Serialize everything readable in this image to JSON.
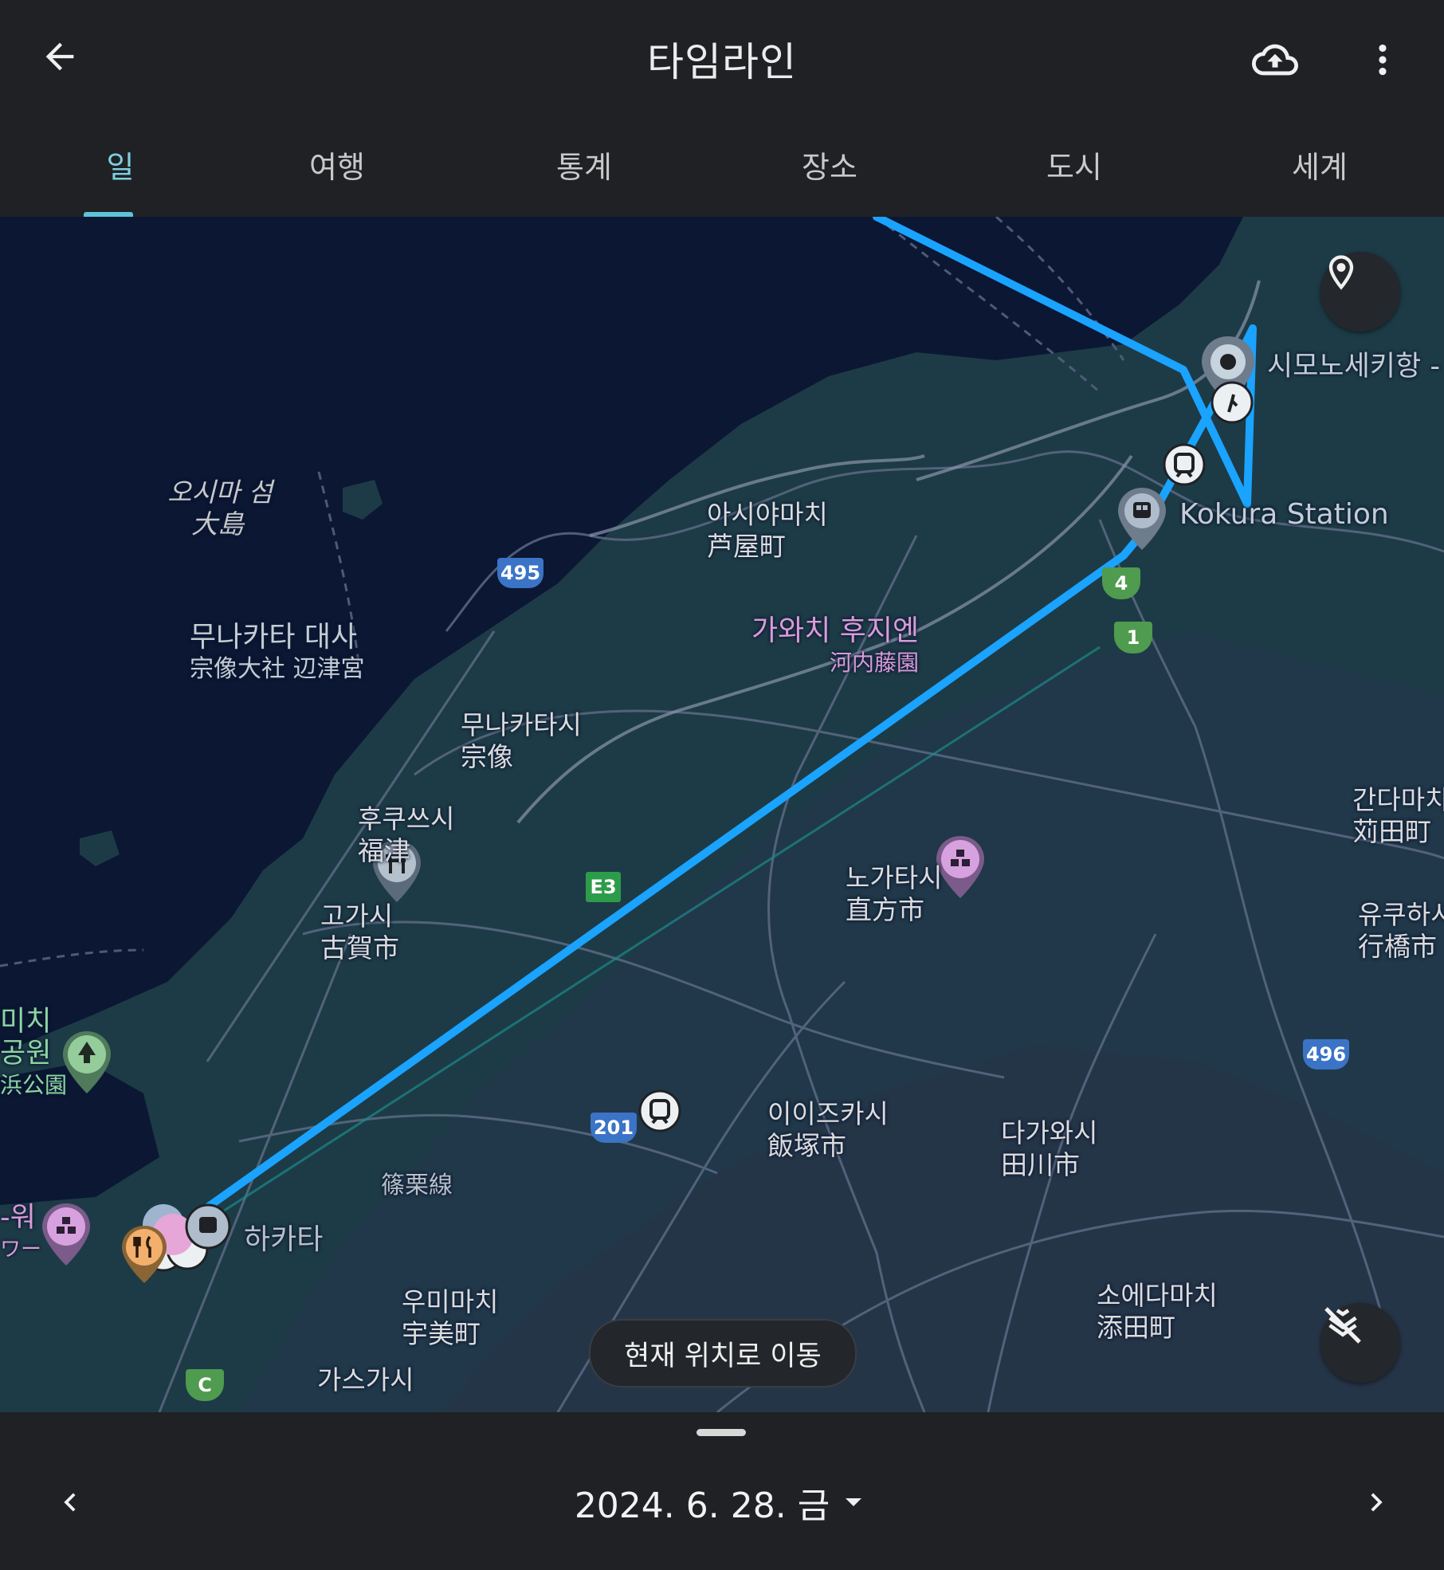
{
  "header": {
    "title": "타임라인",
    "back_icon": "arrow-left-icon",
    "upload_icon": "cloud-upload-icon",
    "menu_icon": "more-vert-icon"
  },
  "tabs": [
    {
      "label": "일",
      "active": true
    },
    {
      "label": "여행",
      "active": false
    },
    {
      "label": "통계",
      "active": false
    },
    {
      "label": "장소",
      "active": false
    },
    {
      "label": "도시",
      "active": false
    },
    {
      "label": "세계",
      "active": false
    }
  ],
  "map": {
    "route_color": "#1aa3ff",
    "labels": {
      "shimonoseki": "시모노세키항 -",
      "kokura": "Kokura Station",
      "oshima_ko": "오시마 섬",
      "oshima_ja": "大島",
      "ashiya_ko": "아시야마치",
      "ashiya_ja": "芦屋町",
      "munakata_taisha_ko": "무나카타 대사",
      "munakata_taisha_ja": "宗像大社 辺津宮",
      "kawachi_ko": "가와치 후지엔",
      "kawachi_ja": "河内藤園",
      "munakata_ko": "무나카타시",
      "munakata_ja": "宗像",
      "fukutsu_ko": "후쿠쓰시",
      "fukutsu_ja": "福津",
      "koga_ko": "고가시",
      "koga_ja": "古賀市",
      "nogata_ko": "노가타시",
      "nogata_ja": "直方市",
      "kanda_ko": "간다마치",
      "kanda_ja": "苅田町",
      "yukuhashi_ko": "유쿠하시",
      "yukuhashi_ja": "行橋市",
      "park_1": "미치",
      "park_2": "공원",
      "park_3": "浜公園",
      "iizuka_ko": "이이즈카시",
      "iizuka_ja": "飯塚市",
      "tagawa_ko": "다가와시",
      "tagawa_ja": "田川市",
      "sasaguri": "篠栗線",
      "hakata": "하카타",
      "umi_ko": "우미마치",
      "umi_ja": "宇美町",
      "soeda_ko": "소에다마치",
      "soeda_ja": "添田町",
      "kasuga_ko": "가스가시",
      "tower_1": "-워",
      "tower_2": "ワー"
    },
    "shields": {
      "r495": "495",
      "r496": "496",
      "r201": "201",
      "e3": "E3",
      "r4": "4",
      "r1": "1",
      "c": "C"
    },
    "go_to_location": "현재 위치로 이동",
    "pin_icon": "location-pin-icon",
    "hide_route_icon": "route-off-icon"
  },
  "footer": {
    "date": "2024. 6. 28. 금",
    "prev_icon": "chevron-left-icon",
    "next_icon": "chevron-right-icon",
    "dropdown_icon": "caret-down-icon"
  }
}
